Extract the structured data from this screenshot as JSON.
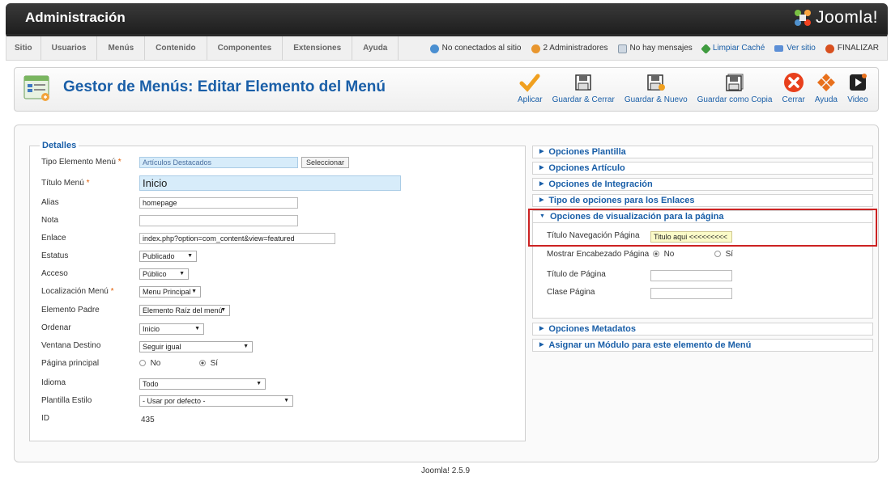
{
  "header": {
    "title": "Administración",
    "logo_text": "Joomla!"
  },
  "menubar": {
    "items": [
      "Sitio",
      "Usuarios",
      "Menús",
      "Contenido",
      "Componentes",
      "Extensiones",
      "Ayuda"
    ],
    "status": {
      "users": "No conectados al sitio",
      "admins": "2 Administradores",
      "messages": "No hay mensajes",
      "cache": "Limpiar Caché",
      "view_site": "Ver sitio",
      "logout": "FINALIZAR"
    }
  },
  "toolbar": {
    "page_title": "Gestor de Menús: Editar Elemento del Menú",
    "buttons": {
      "apply": "Aplicar",
      "save_close": "Guardar & Cerrar",
      "save_new": "Guardar & Nuevo",
      "save_copy": "Guardar como Copia",
      "close": "Cerrar",
      "help": "Ayuda",
      "video": "Video"
    }
  },
  "details": {
    "legend": "Detalles",
    "type_label": "Tipo Elemento Menú",
    "type_value": "Artículos Destacados",
    "select_button": "Seleccionar",
    "title_label": "Título Menú",
    "title_value": "Inicio",
    "alias_label": "Alias",
    "alias_value": "homepage",
    "note_label": "Nota",
    "note_value": "",
    "link_label": "Enlace",
    "link_value": "index.php?option=com_content&view=featured",
    "status_label": "Estatus",
    "status_value": "Publicado",
    "access_label": "Acceso",
    "access_value": "Público",
    "location_label": "Localización Menú",
    "location_value": "Menu Principal",
    "parent_label": "Elemento Padre",
    "parent_value": "Elemento Raíz del menú",
    "order_label": "Ordenar",
    "order_value": "Inicio",
    "target_label": "Ventana Destino",
    "target_value": "Seguir igual",
    "home_label": "Página principal",
    "home_no": "No",
    "home_yes": "Sí",
    "lang_label": "Idioma",
    "lang_value": "Todo",
    "template_label": "Plantilla Estilo",
    "template_value": "- Usar por defecto -",
    "id_label": "ID",
    "id_value": "435"
  },
  "panels": {
    "p1": "Opciones Plantilla",
    "p2": "Opciones Artículo",
    "p3": "Opciones de Integración",
    "p4": "Tipo de opciones para los Enlaces",
    "p5": "Opciones de visualización para la página",
    "p6": "Opciones Metadatos",
    "p7": "Asignar un Módulo para este elemento de Menú"
  },
  "page_display": {
    "nav_title_label": "Título Navegación Página",
    "nav_title_value": "Titulo aqui <<<<<<<<<",
    "show_heading_label": "Mostrar Encabezado Página",
    "show_heading_no": "No",
    "show_heading_yes": "Sí",
    "page_title_label": "Título de Página",
    "page_class_label": "Clase Página"
  },
  "footer": {
    "version": "Joomla! 2.5.9"
  }
}
